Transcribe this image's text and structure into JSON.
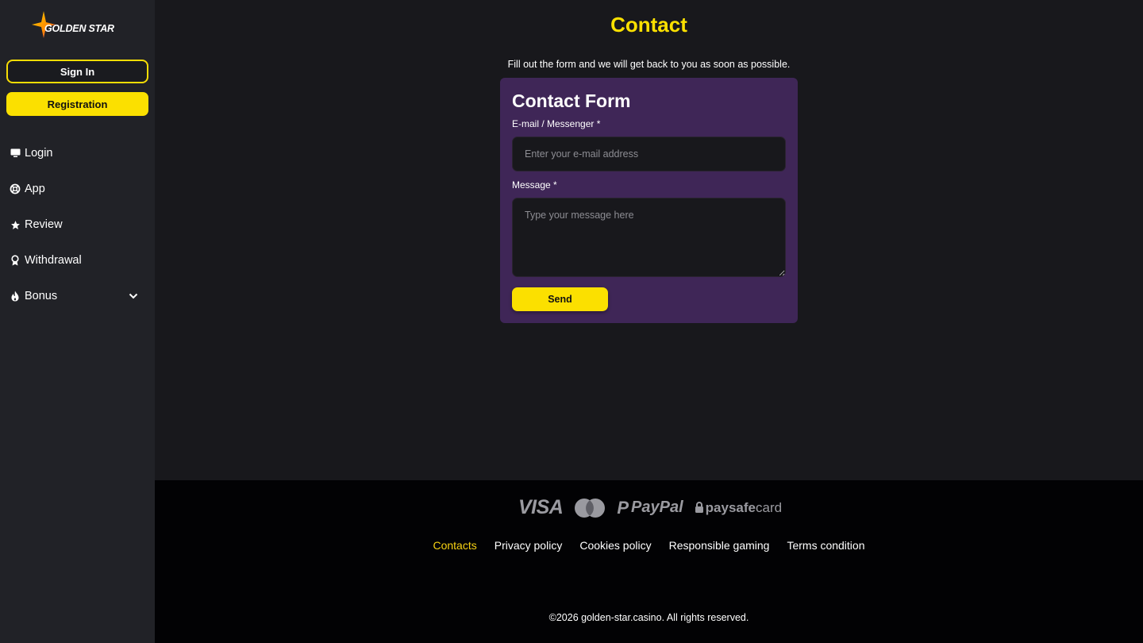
{
  "brand": {
    "logo_text": "GOLDEN STAR"
  },
  "sidebar": {
    "signin_label": "Sign In",
    "registration_label": "Registration",
    "items": [
      {
        "label": "Login",
        "icon": "monitor-icon"
      },
      {
        "label": "App",
        "icon": "lifebuoy-icon"
      },
      {
        "label": "Review",
        "icon": "star-icon"
      },
      {
        "label": "Withdrawal",
        "icon": "award-icon"
      },
      {
        "label": "Bonus",
        "icon": "fire-icon",
        "expandable": true
      }
    ]
  },
  "main": {
    "title": "Contact",
    "subtitle": "Fill out the form and we will get back to you as soon as possible.",
    "form": {
      "title": "Contact Form",
      "email_label": "E-mail / Messenger *",
      "email_placeholder": "Enter your e-mail address",
      "email_value": "",
      "message_label": "Message *",
      "message_placeholder": "Type your message here",
      "message_value": "",
      "send_label": "Send"
    }
  },
  "footer": {
    "payments": {
      "visa": "VISA",
      "paypal": "PayPal",
      "paysafe_a": "paysafe",
      "paysafe_b": "card"
    },
    "links": [
      {
        "label": "Contacts",
        "active": true
      },
      {
        "label": "Privacy policy",
        "active": false
      },
      {
        "label": "Cookies policy",
        "active": false
      },
      {
        "label": "Responsible gaming",
        "active": false
      },
      {
        "label": "Terms condition",
        "active": false
      }
    ],
    "copyright": "©2026 golden-star.casino. All rights reserved."
  },
  "colors": {
    "accent": "#fbe000",
    "background": "#18181c",
    "sidebar": "#212227",
    "form_card": "#3f2657",
    "footer": "#020204",
    "active_link": "#f7d213"
  }
}
